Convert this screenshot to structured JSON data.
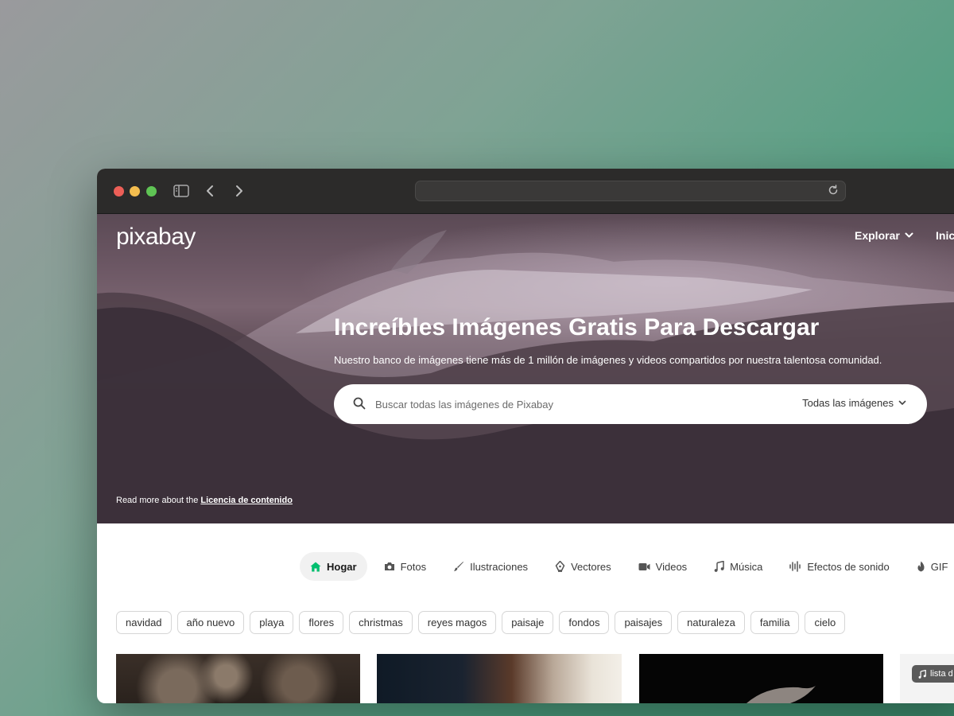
{
  "browser": {
    "url": ""
  },
  "header": {
    "logo": "pixabay",
    "explore_label": "Explorar",
    "login_label": "Inici"
  },
  "hero": {
    "title": "Increíbles Imágenes Gratis Para Descargar",
    "subtitle": "Nuestro banco de imágenes tiene más de 1 millón de imágenes y videos compartidos por nuestra talentosa comunidad.",
    "search_placeholder": "Buscar todas las imágenes de Pixabay",
    "search_type": "Todas las imágenes",
    "license_prefix": "Read more about the ",
    "license_link": "Licencia de contenido"
  },
  "tabs": [
    {
      "label": "Hogar",
      "icon": "home-icon",
      "active": true
    },
    {
      "label": "Fotos",
      "icon": "camera-icon"
    },
    {
      "label": "Ilustraciones",
      "icon": "brush-icon"
    },
    {
      "label": "Vectores",
      "icon": "pen-nib-icon"
    },
    {
      "label": "Videos",
      "icon": "video-icon"
    },
    {
      "label": "Música",
      "icon": "music-note-icon"
    },
    {
      "label": "Efectos de sonido",
      "icon": "waveform-icon"
    },
    {
      "label": "GIF",
      "icon": "flame-icon"
    }
  ],
  "tags": [
    "navidad",
    "año nuevo",
    "playa",
    "flores",
    "christmas",
    "reyes magos",
    "paisaje",
    "fondos",
    "paisajes",
    "naturaleza",
    "familia",
    "cielo"
  ],
  "music_badge": "lista d",
  "colors": {
    "accent_green": "#02be6e",
    "titlebar": "#2c2b2a"
  }
}
